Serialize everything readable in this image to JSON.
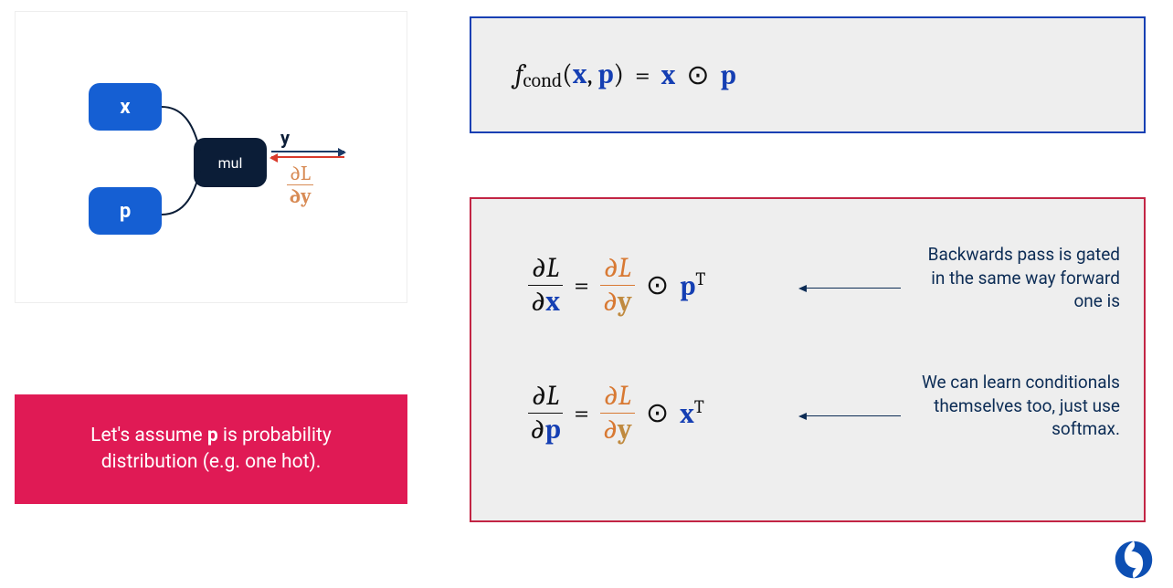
{
  "diagram": {
    "x_label": "x",
    "p_label": "p",
    "op_label": "mul",
    "out_label": "y",
    "grad_num": "∂L",
    "grad_den": "∂y"
  },
  "assume": {
    "pre": "Let's assume ",
    "var": "p",
    "post": " is probability distribution (e.g. one hot)."
  },
  "eq_forward": {
    "f": "f",
    "sub": "cond",
    "arg_x": "x",
    "arg_p": "p",
    "rhs_x": "x",
    "op": "⊙",
    "rhs_p": "p"
  },
  "eq_dx": {
    "lhs_num": "∂L",
    "lhs_den_d": "∂",
    "lhs_den_v": "x",
    "rhs_num": "∂L",
    "rhs_den_d": "∂",
    "rhs_den_v": "y",
    "op": "⊙",
    "tail_v": "p",
    "tail_sup": "T",
    "note": "Backwards pass is gated in the same way forward one is"
  },
  "eq_dp": {
    "lhs_num": "∂L",
    "lhs_den_d": "∂",
    "lhs_den_v": "p",
    "rhs_num": "∂L",
    "rhs_den_d": "∂",
    "rhs_den_v": "y",
    "op": "⊙",
    "tail_v": "x",
    "tail_sup": "T",
    "note": "We can learn conditionals themselves too, just use softmax."
  }
}
